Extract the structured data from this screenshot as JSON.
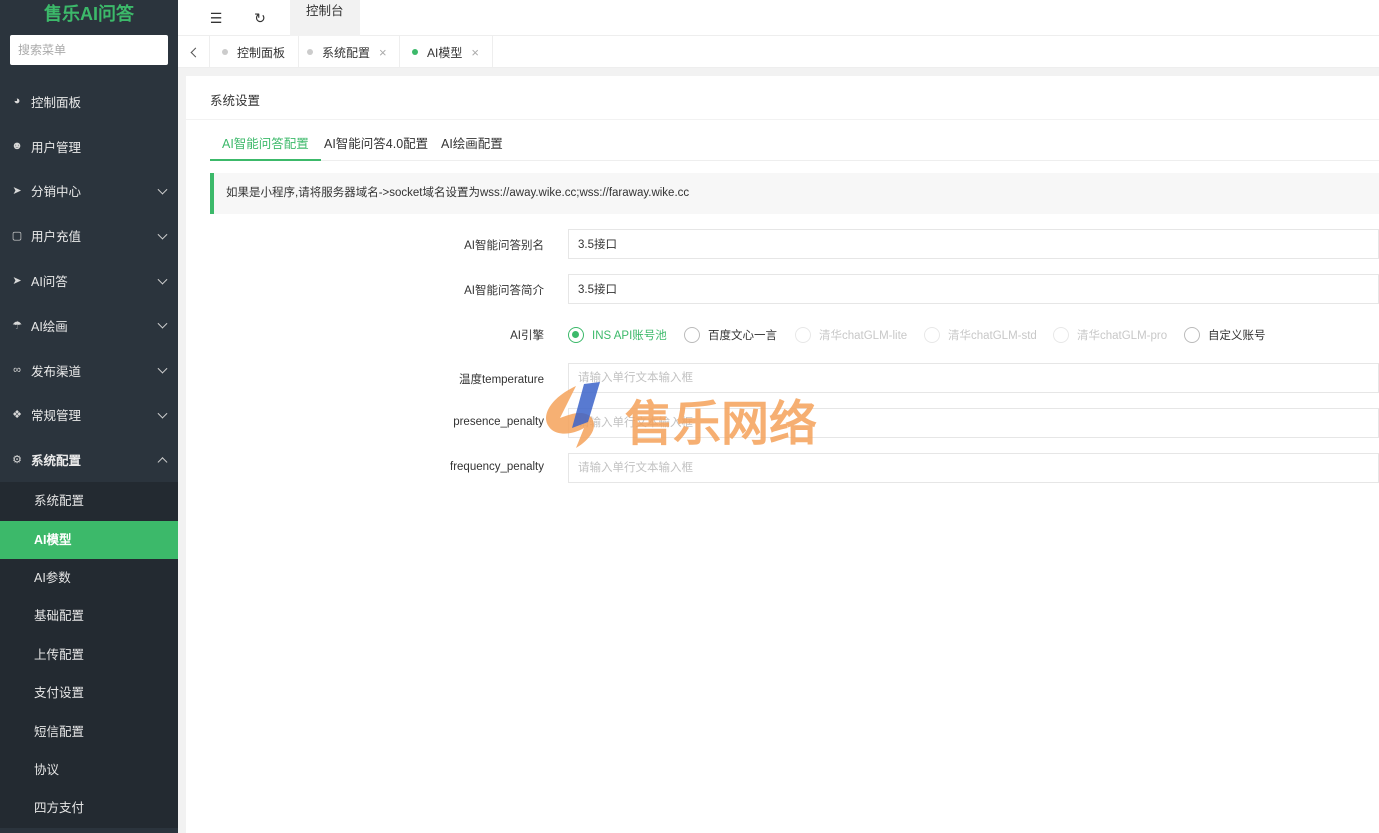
{
  "app": {
    "title": "售乐AI问答"
  },
  "search": {
    "placeholder": "搜索菜单"
  },
  "sidebar": {
    "items": [
      {
        "label": "控制面板",
        "icon": "dashboard-icon"
      },
      {
        "label": "用户管理",
        "icon": "user-icon"
      },
      {
        "label": "分销中心",
        "icon": "share-icon"
      },
      {
        "label": "用户充值",
        "icon": "box-icon"
      },
      {
        "label": "AI问答",
        "icon": "send-icon"
      },
      {
        "label": "AI绘画",
        "icon": "umbrella-icon"
      },
      {
        "label": "发布渠道",
        "icon": "link-icon"
      },
      {
        "label": "常规管理",
        "icon": "tools-icon"
      },
      {
        "label": "系统配置",
        "icon": "gear-icon"
      }
    ],
    "subitems": [
      {
        "label": "系统配置"
      },
      {
        "label": "AI模型"
      },
      {
        "label": "AI参数"
      },
      {
        "label": "基础配置"
      },
      {
        "label": "上传配置"
      },
      {
        "label": "支付设置"
      },
      {
        "label": "短信配置"
      },
      {
        "label": "协议"
      },
      {
        "label": "四方支付"
      }
    ]
  },
  "topbar": {
    "console_tab": "控制台"
  },
  "page_tabs": [
    {
      "label": "控制面板"
    },
    {
      "label": "系统配置",
      "close": "×"
    },
    {
      "label": "AI模型",
      "close": "×"
    }
  ],
  "card": {
    "title": "系统设置"
  },
  "config_tabs": [
    {
      "label": "AI智能问答配置"
    },
    {
      "label": "AI智能问答4.0配置"
    },
    {
      "label": "AI绘画配置"
    }
  ],
  "notice": "如果是小程序,请将服务器域名->socket域名设置为wss://away.wike.cc;wss://faraway.wike.cc",
  "form": {
    "alias": {
      "label": "AI智能问答别名",
      "value": "3.5接口"
    },
    "intro": {
      "label": "AI智能问答简介",
      "value": "3.5接口"
    },
    "engine": {
      "label": "AI引擎",
      "options": [
        {
          "label": "INS API账号池",
          "state": "checked"
        },
        {
          "label": "百度文心一言",
          "state": "normal"
        },
        {
          "label": "清华chatGLM-lite",
          "state": "disabled"
        },
        {
          "label": "清华chatGLM-std",
          "state": "disabled"
        },
        {
          "label": "清华chatGLM-pro",
          "state": "disabled"
        },
        {
          "label": "自定义账号",
          "state": "normal"
        }
      ]
    },
    "temperature": {
      "label": "温度temperature",
      "placeholder": "请输入单行文本输入框"
    },
    "presence_penalty": {
      "label": "presence_penalty",
      "placeholder": "请输入单行文本输入框"
    },
    "frequency_penalty": {
      "label": "frequency_penalty",
      "placeholder": "请输入单行文本输入框"
    }
  },
  "watermark": {
    "text": "售乐网络"
  },
  "colors": {
    "accent": "#3cb96a",
    "sidebar_bg": "#2b343d",
    "watermark_orange": "#f5a25a",
    "watermark_blue": "#3b63c9"
  }
}
